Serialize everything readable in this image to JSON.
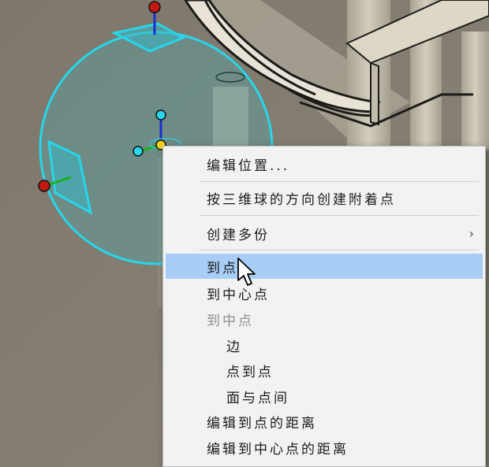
{
  "context_menu": {
    "items": [
      {
        "label": "编辑位置...",
        "enabled": true
      },
      {
        "label": "按三维球的方向创建附着点",
        "enabled": true
      },
      {
        "label": "创建多份",
        "enabled": true,
        "submenu_arrow": "›"
      },
      {
        "label": "到点",
        "enabled": true,
        "highlighted": true
      },
      {
        "label": "到中心点",
        "enabled": true
      },
      {
        "label": "到中点",
        "enabled": false
      },
      {
        "label": "边",
        "enabled": true
      },
      {
        "label": "点到点",
        "enabled": true
      },
      {
        "label": "面与点间",
        "enabled": true
      },
      {
        "label": "编辑到点的距离",
        "enabled": true
      },
      {
        "label": "编辑到中心点的距离",
        "enabled": true
      }
    ]
  },
  "colors": {
    "highlight": "#a8cef7",
    "gizmo_ring": "#27d6ea",
    "handle_red": "#c21a12",
    "axis_blue": "#1a2fd1",
    "axis_green": "#18b31f",
    "background": "#7d766b"
  },
  "icons": [
    "mouse-cursor-icon"
  ]
}
